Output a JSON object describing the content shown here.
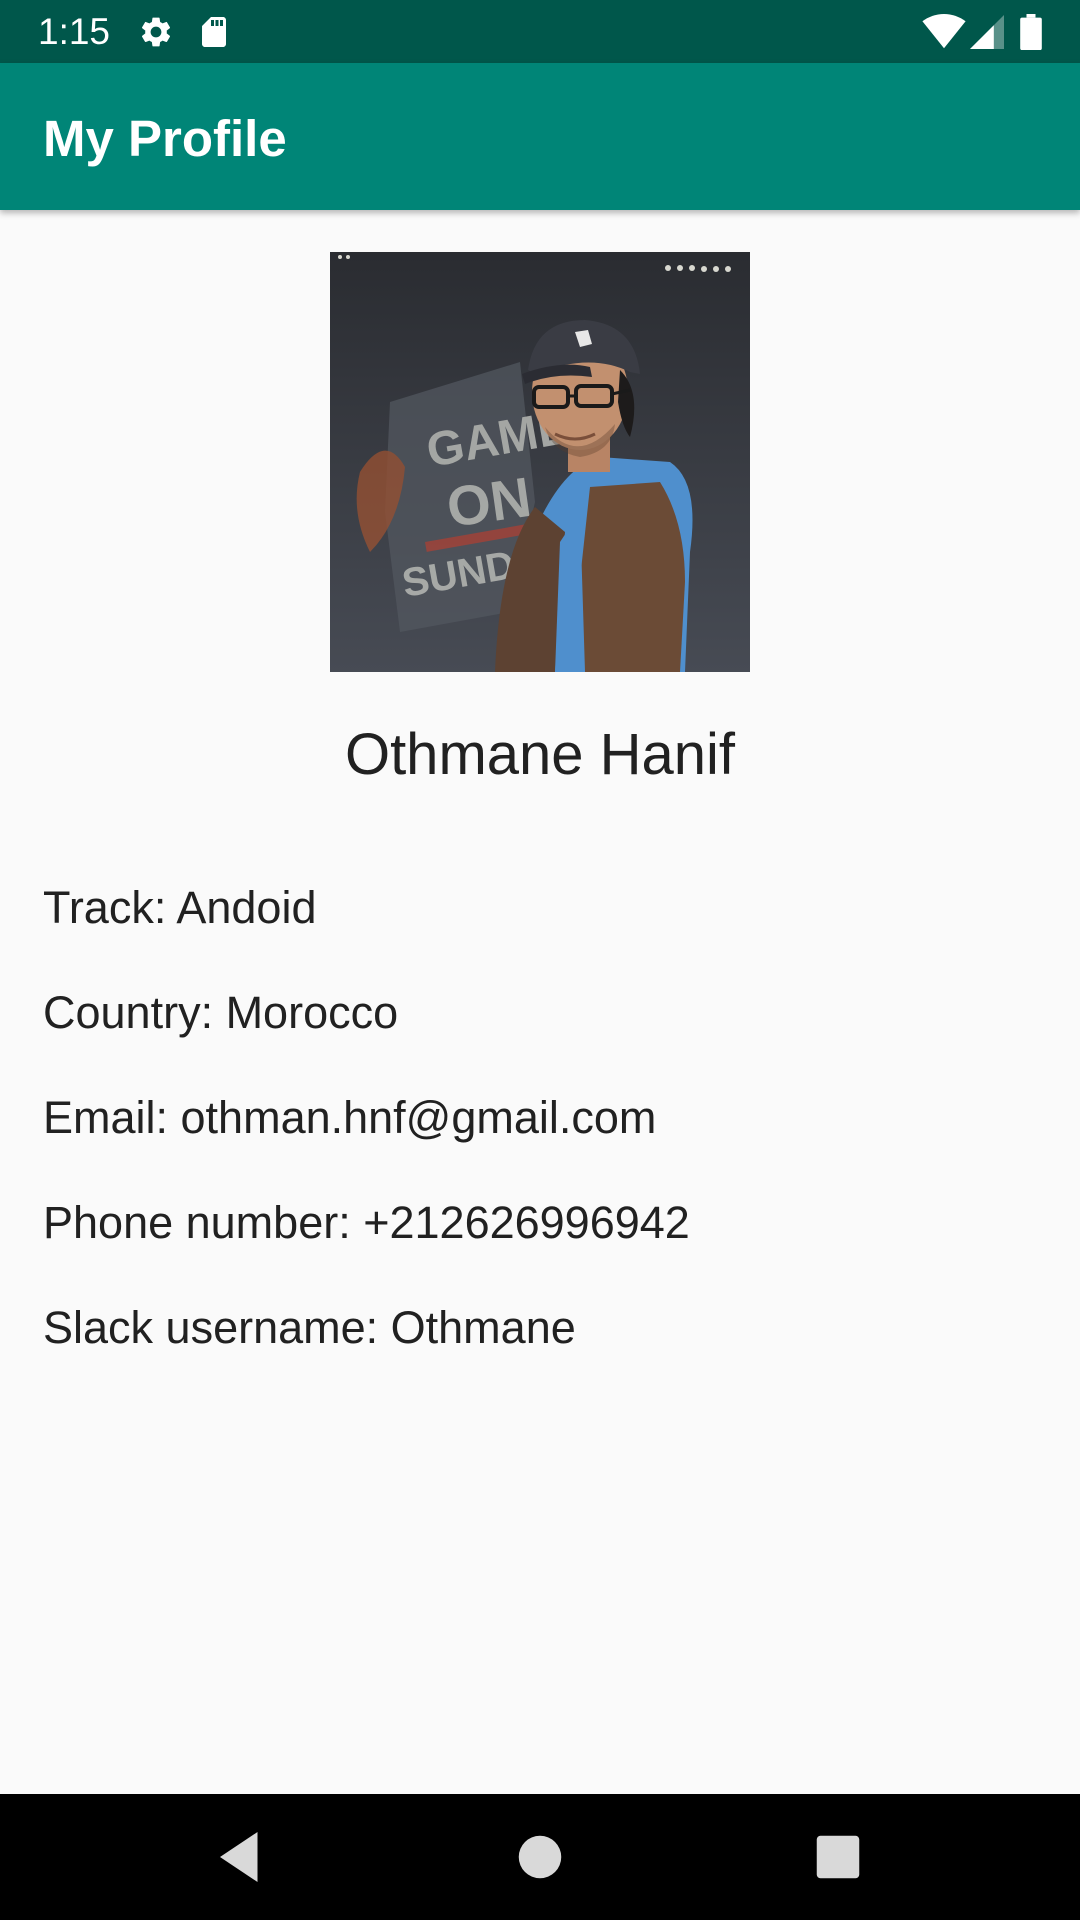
{
  "status_bar": {
    "time": "1:15",
    "icons": [
      "settings-icon",
      "sd-card-icon",
      "wifi-icon",
      "signal-icon",
      "battery-icon"
    ]
  },
  "app_bar": {
    "title": "My Profile",
    "color": "#008577",
    "status_color": "#00574b"
  },
  "profile": {
    "photo_icon": "profile-photo",
    "name": "Othmane Hanif",
    "track": "Track: Andoid",
    "country": "Country: Morocco",
    "email": "Email: othman.hnf@gmail.com",
    "phone": "Phone number: +212626996942",
    "slack": "Slack username: Othmane"
  },
  "nav_bar": {
    "buttons": [
      "back-icon",
      "home-icon",
      "recents-icon"
    ]
  }
}
